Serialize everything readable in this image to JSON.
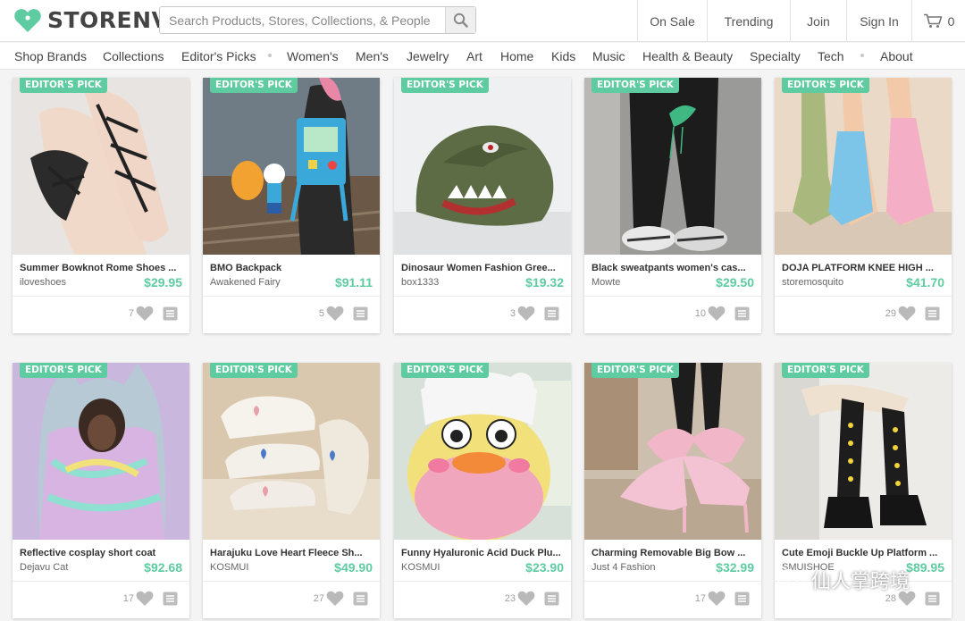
{
  "brand": {
    "name": "STORENVY",
    "accent": "#5ecba1"
  },
  "search": {
    "placeholder": "Search Products, Stores, Collections, & People",
    "icon": "search-icon"
  },
  "topnav": [
    {
      "label": "On Sale"
    },
    {
      "label": "Trending"
    },
    {
      "label": "Join"
    },
    {
      "label": "Sign In"
    }
  ],
  "cart": {
    "count": "0",
    "icon": "cart-icon"
  },
  "categories": [
    "Shop Brands",
    "Collections",
    "Editor's Picks",
    "Women's",
    "Men's",
    "Jewelry",
    "Art",
    "Home",
    "Kids",
    "Music",
    "Health & Beauty",
    "Specialty",
    "Tech",
    "About"
  ],
  "badge_label": "EDITOR'S PICK",
  "products": [
    {
      "title": "Summer Bowknot Rome Shoes ...",
      "store": "iloveshoes",
      "price": "$29.95",
      "likes": "7"
    },
    {
      "title": "BMO Backpack",
      "store": "Awakened Fairy",
      "price": "$91.11",
      "likes": "5"
    },
    {
      "title": "Dinosaur Women Fashion Gree...",
      "store": "box1333",
      "price": "$19.32",
      "likes": "3"
    },
    {
      "title": "Black sweatpants women's cas...",
      "store": "Mowte",
      "price": "$29.50",
      "likes": "10"
    },
    {
      "title": "DOJA PLATFORM KNEE HIGH ...",
      "store": "storemosquito",
      "price": "$41.70",
      "likes": "29"
    },
    {
      "title": "Reflective cosplay short coat",
      "store": "Dejavu Cat",
      "price": "$92.68",
      "likes": "17"
    },
    {
      "title": "Harajuku Love Heart Fleece Sh...",
      "store": "KOSMUI",
      "price": "$49.90",
      "likes": "27"
    },
    {
      "title": "Funny Hyaluronic Acid Duck Plu...",
      "store": "KOSMUI",
      "price": "$23.90",
      "likes": "23"
    },
    {
      "title": "Charming Removable Big Bow ...",
      "store": "Just 4 Fashion",
      "price": "$32.99",
      "likes": "17"
    },
    {
      "title": "Cute Emoji Buckle Up Platform ...",
      "store": "SMUISHOE",
      "price": "$89.95",
      "likes": "28"
    }
  ],
  "watermark": {
    "text": "仙人掌跨境"
  }
}
